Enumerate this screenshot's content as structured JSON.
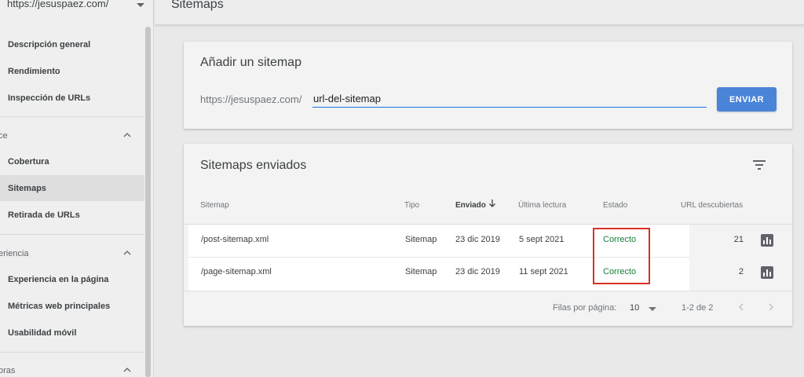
{
  "sidebar": {
    "property": "https://jesuspaez.com/",
    "items": [
      {
        "label": "Descripción general"
      },
      {
        "label": "Rendimiento"
      },
      {
        "label": "Inspección de URLs"
      }
    ],
    "sections": [
      {
        "label": "ce",
        "items": [
          {
            "label": "Cobertura"
          },
          {
            "label": "Sitemaps",
            "active": true
          },
          {
            "label": "Retirada de URLs"
          }
        ]
      },
      {
        "label": "eriencia",
        "items": [
          {
            "label": "Experiencia en la página"
          },
          {
            "label": "Métricas web principales"
          },
          {
            "label": "Usabilidad móvil"
          }
        ]
      },
      {
        "label": "oras",
        "items": []
      }
    ]
  },
  "header": {
    "title": "Sitemaps"
  },
  "add_sitemap": {
    "title": "Añadir un sitemap",
    "url_prefix": "https://jesuspaez.com/",
    "input_value": "url-del-sitemap",
    "submit_label": "ENVIAR"
  },
  "sent_sitemaps": {
    "title": "Sitemaps enviados",
    "columns": {
      "sitemap": "Sitemap",
      "type": "Tipo",
      "sent": "Enviado",
      "last_read": "Última lectura",
      "status": "Estado",
      "discovered": "URL descubiertas"
    },
    "rows": [
      {
        "sitemap": "/post-sitemap.xml",
        "type": "Sitemap",
        "sent": "23 dic 2019",
        "last_read": "5 sept 2021",
        "status": "Correcto",
        "discovered": "21"
      },
      {
        "sitemap": "/page-sitemap.xml",
        "type": "Sitemap",
        "sent": "23 dic 2019",
        "last_read": "11 sept 2021",
        "status": "Correcto",
        "discovered": "2"
      }
    ],
    "pagination": {
      "rows_per_page_label": "Filas por página:",
      "rows_per_page": "10",
      "range": "1-2 de 2"
    }
  },
  "colors": {
    "accent": "#1a73e8",
    "button": "#4a84d8",
    "status_ok": "#188038",
    "highlight_box": "#d93025"
  },
  "icons": [
    "chevron-down-icon",
    "chevron-up-icon",
    "filter-icon",
    "arrow-down-icon",
    "bar-chart-icon",
    "chevron-left-icon",
    "chevron-right-icon"
  ]
}
